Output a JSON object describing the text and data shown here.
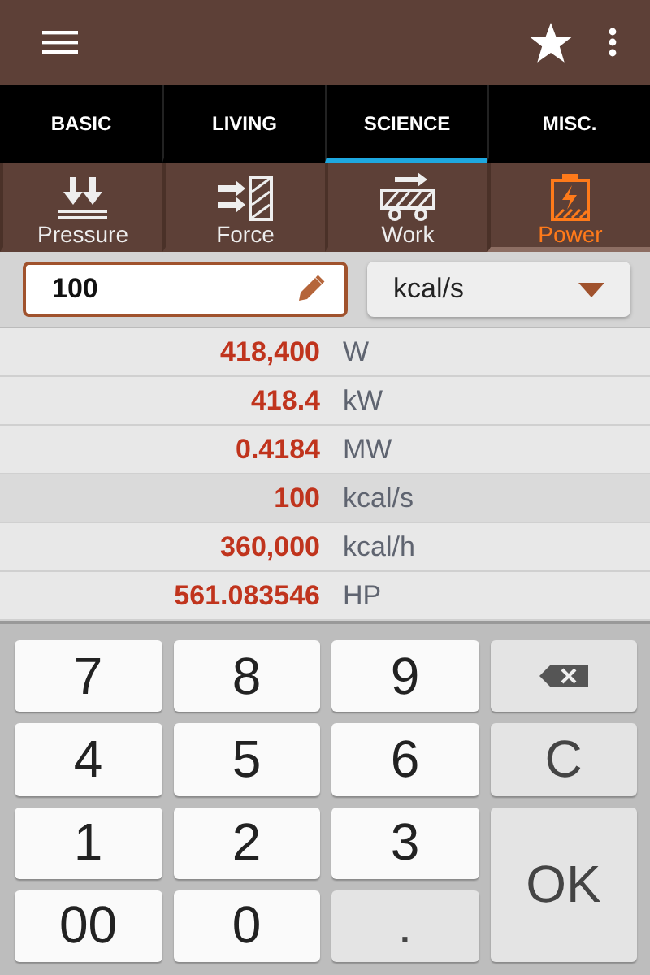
{
  "tabs": [
    {
      "label": "BASIC",
      "selected": false
    },
    {
      "label": "LIVING",
      "selected": false
    },
    {
      "label": "SCIENCE",
      "selected": true
    },
    {
      "label": "MISC.",
      "selected": false
    }
  ],
  "categories": [
    {
      "label": "Pressure",
      "kind": "pressure",
      "selected": false
    },
    {
      "label": "Force",
      "kind": "force",
      "selected": false
    },
    {
      "label": "Work",
      "kind": "work",
      "selected": false
    },
    {
      "label": "Power",
      "kind": "power",
      "selected": true
    }
  ],
  "input": {
    "value": "100"
  },
  "unit_select": {
    "value": "kcal/s"
  },
  "results": [
    {
      "value": "418,400",
      "unit": "W",
      "selected": false
    },
    {
      "value": "418.4",
      "unit": "kW",
      "selected": false
    },
    {
      "value": "0.4184",
      "unit": "MW",
      "selected": false
    },
    {
      "value": "100",
      "unit": "kcal/s",
      "selected": true
    },
    {
      "value": "360,000",
      "unit": "kcal/h",
      "selected": false
    },
    {
      "value": "561.083546",
      "unit": "HP",
      "selected": false
    }
  ],
  "keypad": [
    {
      "kind": "digit",
      "label": "7"
    },
    {
      "kind": "digit",
      "label": "8"
    },
    {
      "kind": "digit",
      "label": "9"
    },
    {
      "kind": "backspace"
    },
    {
      "kind": "digit",
      "label": "4"
    },
    {
      "kind": "digit",
      "label": "5"
    },
    {
      "kind": "digit",
      "label": "6"
    },
    {
      "kind": "clear",
      "label": "C"
    },
    {
      "kind": "digit",
      "label": "1"
    },
    {
      "kind": "digit",
      "label": "2"
    },
    {
      "kind": "digit",
      "label": "3"
    },
    {
      "kind": "ok",
      "label": "OK"
    },
    {
      "kind": "digit",
      "label": "00"
    },
    {
      "kind": "digit",
      "label": "0"
    },
    {
      "kind": "dot",
      "label": "."
    }
  ]
}
